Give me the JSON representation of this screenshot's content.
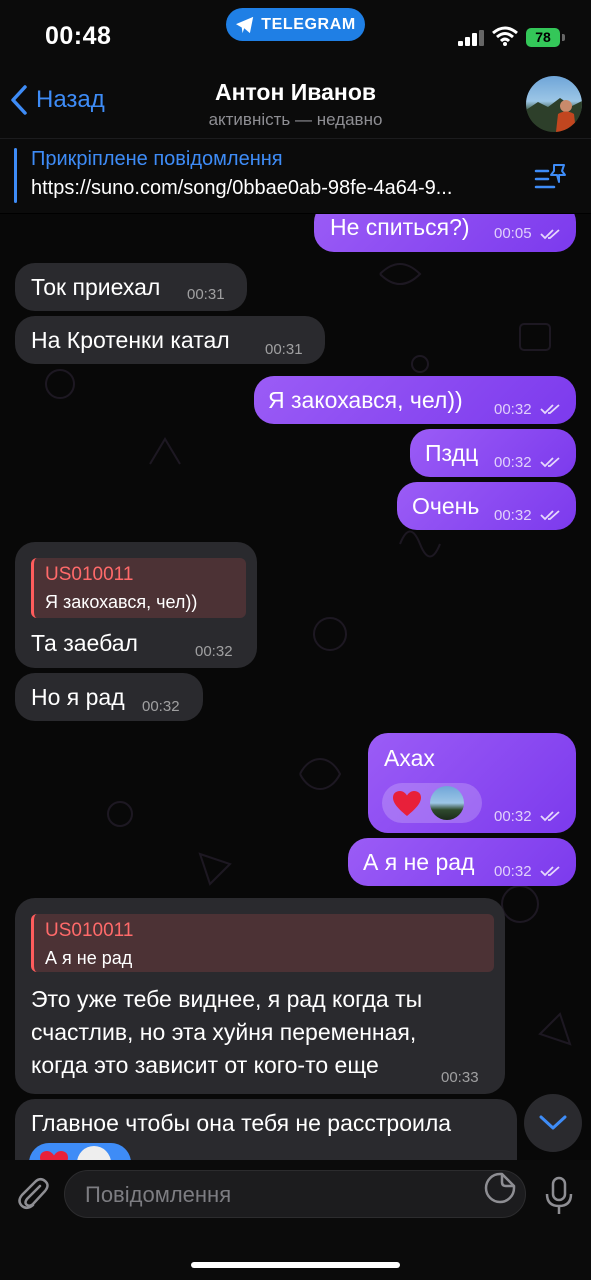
{
  "status_bar": {
    "time": "00:48",
    "app_pill": "TELEGRAM",
    "battery": "78"
  },
  "header": {
    "back_label": "Назад",
    "title": "Антон Иванов",
    "subtitle": "активність — недавно"
  },
  "pinned": {
    "title": "Прикріплене повідомлення",
    "text": "https://suno.com/song/0bbae0ab-98fe-4a64-9..."
  },
  "messages": [
    {
      "dir": "out",
      "text": "Не спиться?)",
      "time": "00:05"
    },
    {
      "dir": "in",
      "text": "Ток приехал",
      "time": "00:31"
    },
    {
      "dir": "in",
      "text": "На Кротенки катал",
      "time": "00:31"
    },
    {
      "dir": "out",
      "text": "Я закохався, чел))",
      "time": "00:32"
    },
    {
      "dir": "out",
      "text": "Пздц",
      "time": "00:32"
    },
    {
      "dir": "out",
      "text": "Очень",
      "time": "00:32"
    },
    {
      "dir": "in",
      "reply_name": "US010011",
      "reply_text": "Я закохався, чел))",
      "text": "Та заебал",
      "time": "00:32"
    },
    {
      "dir": "in",
      "text": "Но я рад",
      "time": "00:32"
    },
    {
      "dir": "out",
      "text": "Ахах",
      "time": "00:32",
      "reaction": "heart"
    },
    {
      "dir": "out",
      "text": "А я не рад",
      "time": "00:32"
    },
    {
      "dir": "in",
      "reply_name": "US010011",
      "reply_text": "А я не рад",
      "lines": [
        "Это уже тебе виднее, я рад когда ты",
        "счастлив, но эта хуйня переменная,",
        "когда это зависит от кого-то еще"
      ],
      "time": "00:33"
    },
    {
      "dir": "in",
      "text": "Главное чтобы она тебя не расстроила"
    }
  ],
  "input": {
    "placeholder": "Повідомлення"
  },
  "colors": {
    "accent": "#3e8cf7",
    "outgoing": "#8b4cf1",
    "incoming": "#2a2a2e",
    "reply_name": "#ff6a6a"
  }
}
